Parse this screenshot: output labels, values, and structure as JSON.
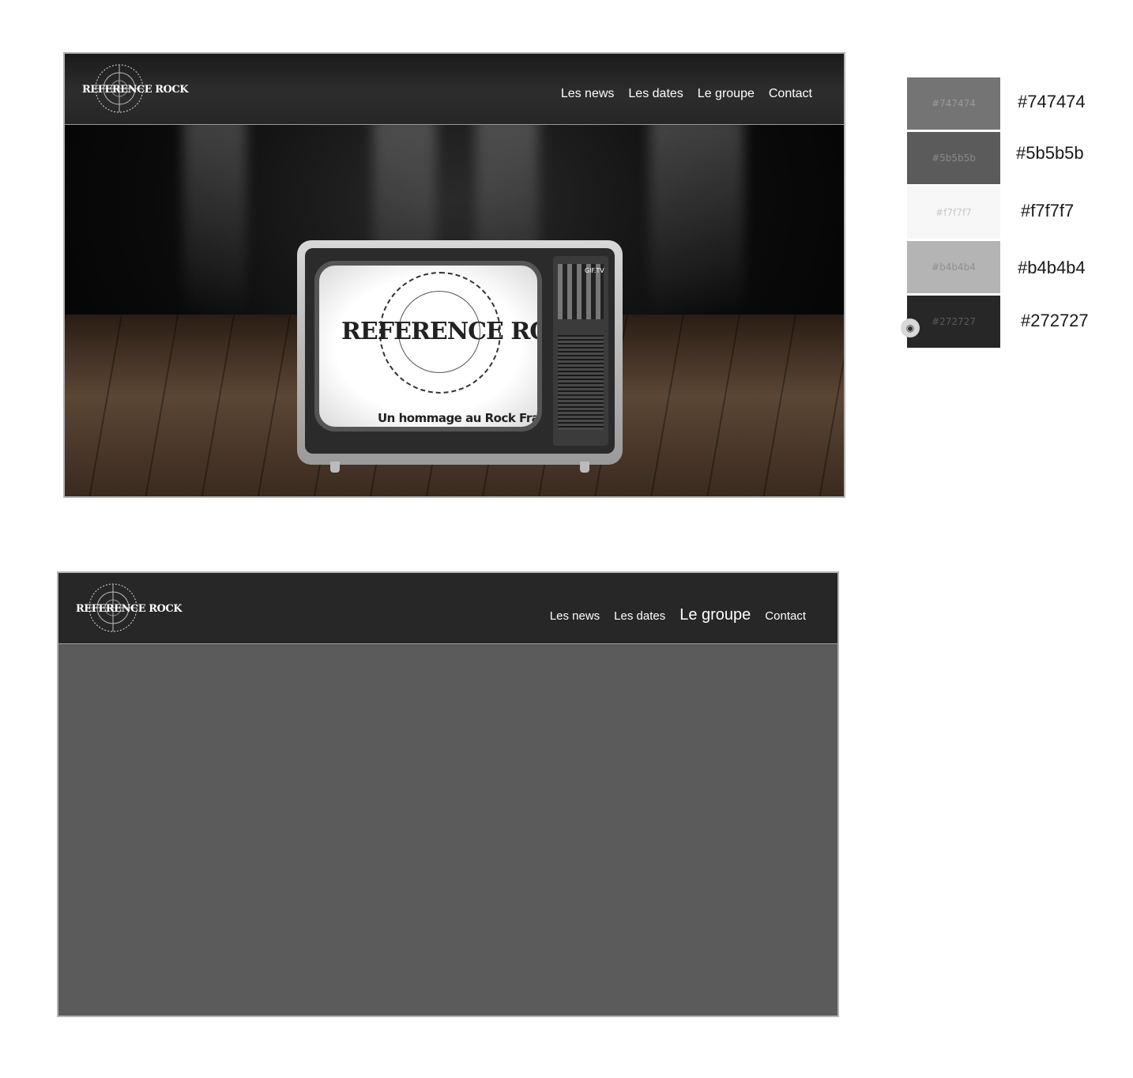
{
  "mockup_top": {
    "logo_text": "REFERENCE ROCK",
    "nav": [
      "Les news",
      "Les dates",
      "Le groupe",
      "Contact"
    ],
    "screen_logo": "REFERENCE ROCK",
    "screen_tagline": "Un hommage au Rock Français",
    "tv_badge": "GIF.TV"
  },
  "mockup_bottom": {
    "logo_text": "REFERENCE ROCK",
    "nav": [
      "Les news",
      "Les dates",
      "Le groupe",
      "Contact"
    ],
    "active_nav": "Le groupe"
  },
  "palette": [
    {
      "hex": "#747474",
      "swatch_text": "#747474",
      "label": "#747474",
      "text_color": "#9a9a9a"
    },
    {
      "hex": "#5b5b5b",
      "swatch_text": "#5b5b5b",
      "label": "#5b5b5b",
      "text_color": "#8a8a8a"
    },
    {
      "hex": "#f7f7f7",
      "swatch_text": "#f7f7f7",
      "label": "#f7f7f7",
      "text_color": "#c8c8c8"
    },
    {
      "hex": "#b4b4b4",
      "swatch_text": "#b4b4b4",
      "label": "#b4b4b4",
      "text_color": "#8f8f8f"
    },
    {
      "hex": "#272727",
      "swatch_text": "#272727",
      "label": "#272727",
      "text_color": "#5a5a5a"
    }
  ]
}
